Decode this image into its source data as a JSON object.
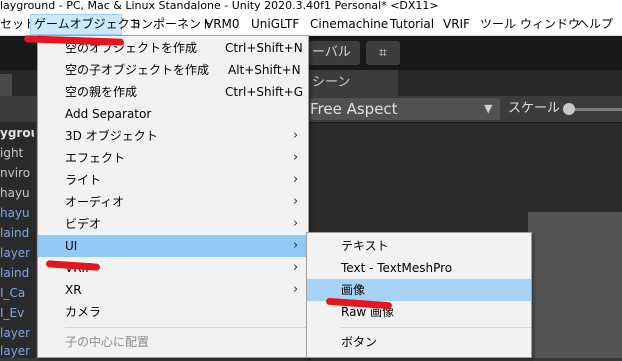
{
  "window": {
    "title": "layground - PC, Mac & Linux Standalone - Unity 2020.3.40f1 Personal* <DX11>"
  },
  "menu_bar": {
    "items": [
      {
        "label": "セット"
      },
      {
        "label": "ゲームオブジェクト",
        "active": true
      },
      {
        "label": "コンポーネント"
      },
      {
        "label": "VRM0"
      },
      {
        "label": "UniGLTF"
      },
      {
        "label": "Cinemachine"
      },
      {
        "label": "Tutorial"
      },
      {
        "label": "VRIF"
      },
      {
        "label": "ツール"
      },
      {
        "label": "ウィンドウ"
      },
      {
        "label": "ヘルプ"
      }
    ]
  },
  "game_object_menu": {
    "items": [
      {
        "label": "空のオブジェクトを作成",
        "shortcut": "Ctrl+Shift+N"
      },
      {
        "label": "空の子オブジェクトを作成",
        "shortcut": "Alt+Shift+N"
      },
      {
        "label": "空の親を作成",
        "shortcut": "Ctrl+Shift+G"
      },
      {
        "label": "Add Separator"
      },
      {
        "label": "3D オブジェクト",
        "submenu": true
      },
      {
        "label": "エフェクト",
        "submenu": true
      },
      {
        "label": "ライト",
        "submenu": true
      },
      {
        "label": "オーディオ",
        "submenu": true
      },
      {
        "label": "ビデオ",
        "submenu": true
      },
      {
        "label": "UI",
        "submenu": true,
        "highlighted": true
      },
      {
        "label": "VRIF",
        "submenu": true
      },
      {
        "label": "XR",
        "submenu": true
      },
      {
        "label": "カメラ"
      },
      {
        "label": "子の中心に配置",
        "disabled": true
      }
    ],
    "arrow": "›"
  },
  "ui_submenu": {
    "items": [
      {
        "label": "テキスト"
      },
      {
        "label": "Text - TextMeshPro"
      },
      {
        "label": "画像",
        "highlighted": true
      },
      {
        "label": "Raw 画像"
      },
      {
        "label": "ボタン"
      }
    ]
  },
  "editor": {
    "toolbar_button": "ーバル",
    "grid_icon": "⌗",
    "scene_tab": "シーン",
    "aspect": "Free Aspect",
    "aspect_arrow": "▼",
    "scale_label": "スケール"
  },
  "hierarchy_rows": [
    {
      "text": "ygrou",
      "style": "bold"
    },
    {
      "text": "ight",
      "style": "normal"
    },
    {
      "text": "nviro",
      "style": "normal"
    },
    {
      "text": "hayu",
      "style": "normal"
    },
    {
      "text": "hayu",
      "style": "blue"
    },
    {
      "text": "laind",
      "style": "blue"
    },
    {
      "text": "layer",
      "style": "blue"
    },
    {
      "text": "laind",
      "style": "blue"
    },
    {
      "text": "I_Ca",
      "style": "blue"
    },
    {
      "text": "I_Ev",
      "style": "blue"
    },
    {
      "text": "layer",
      "style": "blue"
    },
    {
      "text": "layer",
      "style": "blue"
    }
  ],
  "colors": {
    "highlight": "#91c9f7",
    "annotation_red": "#e8141b",
    "menu_active": "#cce8ff"
  }
}
